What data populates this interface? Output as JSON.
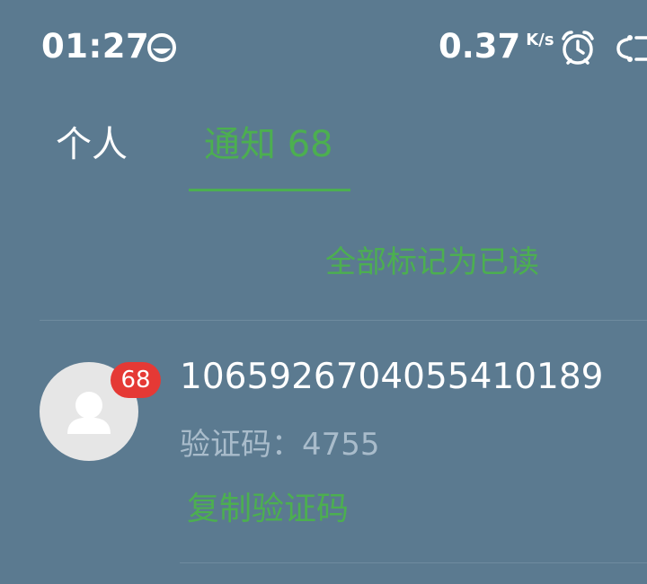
{
  "status_bar": {
    "time": "01:27",
    "net_speed": "0.37",
    "net_unit": "K/s",
    "icons": [
      "app-status-icon",
      "alarm-icon",
      "sync-icon"
    ]
  },
  "tabs": {
    "personal": "个人",
    "notifications": "通知 68",
    "active": "notifications"
  },
  "actions": {
    "mark_all_read": "全部标记为已读"
  },
  "notifications": [
    {
      "badge": "68",
      "sender": "10659267040554101​89",
      "preview": "验证码：4755",
      "action": "复制验证码"
    }
  ],
  "colors": {
    "background": "#5b7a90",
    "accent": "#4caf50",
    "badge": "#e53935",
    "secondary_text": "#a9bccb"
  }
}
